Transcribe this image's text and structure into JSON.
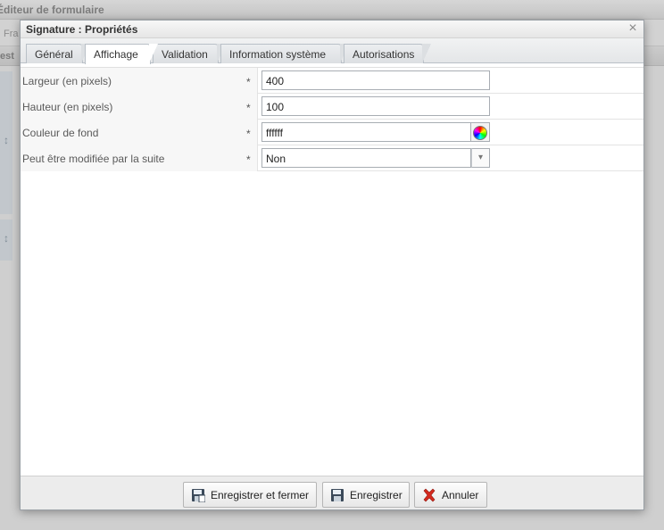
{
  "background": {
    "title": "Éditeur de formulaire",
    "toolbar_text": "Fra",
    "header_text": "est"
  },
  "modal": {
    "title": "Signature : Propriétés",
    "close_label": "×",
    "tabs": [
      {
        "label": "Général",
        "active": false
      },
      {
        "label": "Affichage",
        "active": true
      },
      {
        "label": "Validation",
        "active": false
      },
      {
        "label": "Information système",
        "active": false
      },
      {
        "label": "Autorisations",
        "active": false
      }
    ],
    "fields": [
      {
        "label": "Largeur (en pixels)",
        "required": "*",
        "value": "400"
      },
      {
        "label": "Hauteur (en pixels)",
        "required": "*",
        "value": "100"
      },
      {
        "label": "Couleur de fond",
        "required": "*",
        "value": "ffffff"
      },
      {
        "label": "Peut être modifiée par la suite",
        "required": "*",
        "value": "Non"
      }
    ],
    "buttons": {
      "save_close": "Enregistrer et fermer",
      "save": "Enregistrer",
      "cancel": "Annuler"
    }
  }
}
